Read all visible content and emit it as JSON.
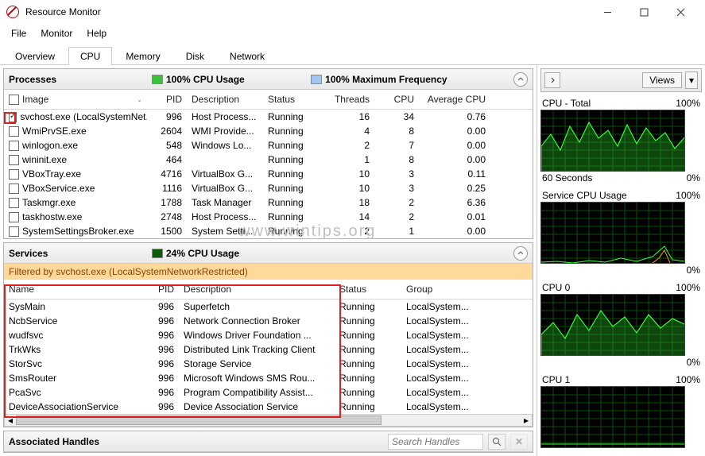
{
  "app": {
    "title": "Resource Monitor"
  },
  "menu": [
    "File",
    "Monitor",
    "Help"
  ],
  "tabs": {
    "items": [
      "Overview",
      "CPU",
      "Memory",
      "Disk",
      "Network"
    ],
    "active": 1
  },
  "processes": {
    "title": "Processes",
    "legend1": "100% CPU Usage",
    "legend2": "100% Maximum Frequency",
    "columns": [
      "Image",
      "PID",
      "Description",
      "Status",
      "Threads",
      "CPU",
      "Average CPU"
    ],
    "rows": [
      {
        "checked": true,
        "image": "svchost.exe (LocalSystemNet...",
        "pid": "996",
        "desc": "Host Process...",
        "status": "Running",
        "threads": "16",
        "cpu": "34",
        "avg": "0.76"
      },
      {
        "checked": false,
        "image": "WmiPrvSE.exe",
        "pid": "2604",
        "desc": "WMI Provide...",
        "status": "Running",
        "threads": "4",
        "cpu": "8",
        "avg": "0.00"
      },
      {
        "checked": false,
        "image": "winlogon.exe",
        "pid": "548",
        "desc": "Windows Lo...",
        "status": "Running",
        "threads": "2",
        "cpu": "7",
        "avg": "0.00"
      },
      {
        "checked": false,
        "image": "wininit.exe",
        "pid": "464",
        "desc": "",
        "status": "Running",
        "threads": "1",
        "cpu": "8",
        "avg": "0.00"
      },
      {
        "checked": false,
        "image": "VBoxTray.exe",
        "pid": "4716",
        "desc": "VirtualBox G...",
        "status": "Running",
        "threads": "10",
        "cpu": "3",
        "avg": "0.11"
      },
      {
        "checked": false,
        "image": "VBoxService.exe",
        "pid": "1116",
        "desc": "VirtualBox G...",
        "status": "Running",
        "threads": "10",
        "cpu": "3",
        "avg": "0.25"
      },
      {
        "checked": false,
        "image": "Taskmgr.exe",
        "pid": "1788",
        "desc": "Task Manager",
        "status": "Running",
        "threads": "18",
        "cpu": "2",
        "avg": "6.36"
      },
      {
        "checked": false,
        "image": "taskhostw.exe",
        "pid": "2748",
        "desc": "Host Process...",
        "status": "Running",
        "threads": "14",
        "cpu": "2",
        "avg": "0.01"
      },
      {
        "checked": false,
        "image": "SystemSettingsBroker.exe",
        "pid": "1500",
        "desc": "System Setti...",
        "status": "Running",
        "threads": "2",
        "cpu": "1",
        "avg": "0.00"
      }
    ]
  },
  "services": {
    "title": "Services",
    "legend1": "24% CPU Usage",
    "filter": "Filtered by svchost.exe (LocalSystemNetworkRestricted)",
    "columns": [
      "Name",
      "PID",
      "Description",
      "Status",
      "Group"
    ],
    "rows": [
      {
        "name": "SysMain",
        "pid": "996",
        "desc": "Superfetch",
        "status": "Running",
        "group": "LocalSystem..."
      },
      {
        "name": "NcbService",
        "pid": "996",
        "desc": "Network Connection Broker",
        "status": "Running",
        "group": "LocalSystem..."
      },
      {
        "name": "wudfsvc",
        "pid": "996",
        "desc": "Windows Driver Foundation ...",
        "status": "Running",
        "group": "LocalSystem..."
      },
      {
        "name": "TrkWks",
        "pid": "996",
        "desc": "Distributed Link Tracking Client",
        "status": "Running",
        "group": "LocalSystem..."
      },
      {
        "name": "StorSvc",
        "pid": "996",
        "desc": "Storage Service",
        "status": "Running",
        "group": "LocalSystem..."
      },
      {
        "name": "SmsRouter",
        "pid": "996",
        "desc": "Microsoft Windows SMS Rou...",
        "status": "Running",
        "group": "LocalSystem..."
      },
      {
        "name": "PcaSvc",
        "pid": "996",
        "desc": "Program Compatibility Assist...",
        "status": "Running",
        "group": "LocalSystem..."
      },
      {
        "name": "DeviceAssociationService",
        "pid": "996",
        "desc": "Device Association Service",
        "status": "Running",
        "group": "LocalSystem..."
      }
    ]
  },
  "charts": {
    "views_label": "Views",
    "list": [
      {
        "title": "CPU - Total",
        "right": "100%",
        "footL": "60 Seconds",
        "footR": "0%"
      },
      {
        "title": "Service CPU Usage",
        "right": "100%",
        "footL": "",
        "footR": "0%"
      },
      {
        "title": "CPU 0",
        "right": "100%",
        "footL": "",
        "footR": "0%"
      },
      {
        "title": "CPU 1",
        "right": "100%",
        "footL": "",
        "footR": ""
      }
    ]
  },
  "handles": {
    "title": "Associated Handles",
    "search_placeholder": "Search Handles"
  },
  "watermark": "www.wintips.org"
}
